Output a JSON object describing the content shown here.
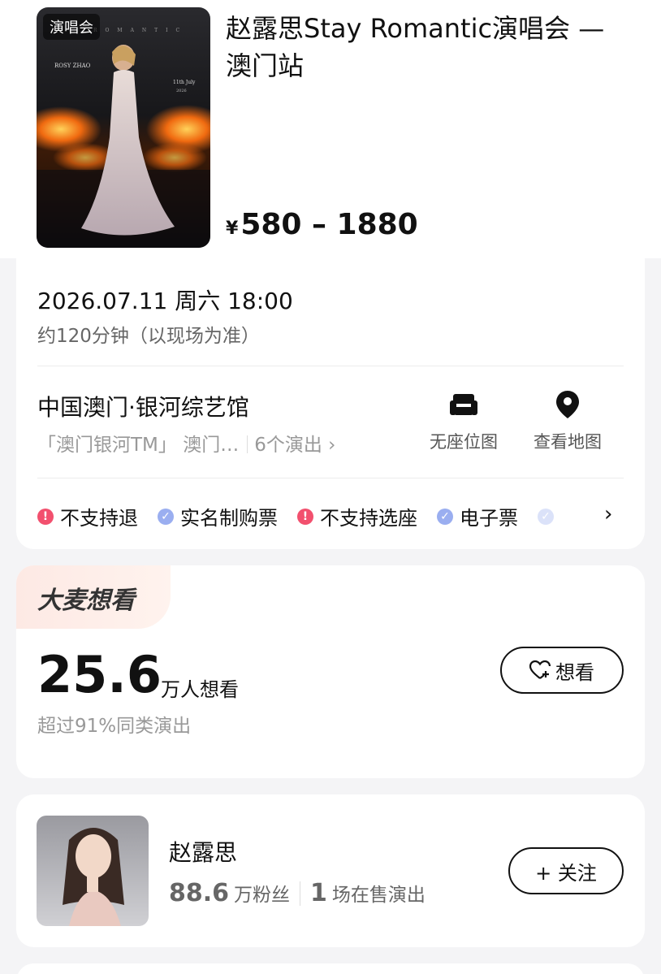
{
  "event": {
    "poster_tag": "演唱会",
    "title": "赵露思Stay Romantic演唱会 — 澳门站",
    "currency": "¥",
    "price_range": "580 – 1880"
  },
  "info": {
    "datetime": "2026.07.11 周六 18:00",
    "duration": "约120分钟（以现场为准）",
    "venue_name": "中国澳门·银河综艺馆",
    "venue_address": "「澳门银河TM」 澳门…",
    "venue_shows": "6个演出 ›",
    "seat_map_label": "无座位图",
    "map_label": "查看地图",
    "tags": [
      {
        "label": "不支持退",
        "type": "warn",
        "icon": "warning-icon"
      },
      {
        "label": "实名制购票",
        "type": "ok",
        "icon": "check-icon"
      },
      {
        "label": "不支持选座",
        "type": "warn",
        "icon": "warning-icon"
      },
      {
        "label": "电子票",
        "type": "ok",
        "icon": "check-icon"
      }
    ],
    "more_arrow": "›"
  },
  "want": {
    "banner": "大麦想看",
    "count": "25.6",
    "unit": "万人想看",
    "subtitle": "超过91%同类演出",
    "button_label": "想看"
  },
  "artist": {
    "name": "赵露思",
    "fans_count": "88.6",
    "fans_label": "万粉丝",
    "shows_count": "1",
    "shows_label": "场在售演出",
    "follow_label": "+ 关注"
  },
  "colors": {
    "warn": "#f2506e",
    "ok": "#9aaef0",
    "background": "#f4f4f6"
  }
}
